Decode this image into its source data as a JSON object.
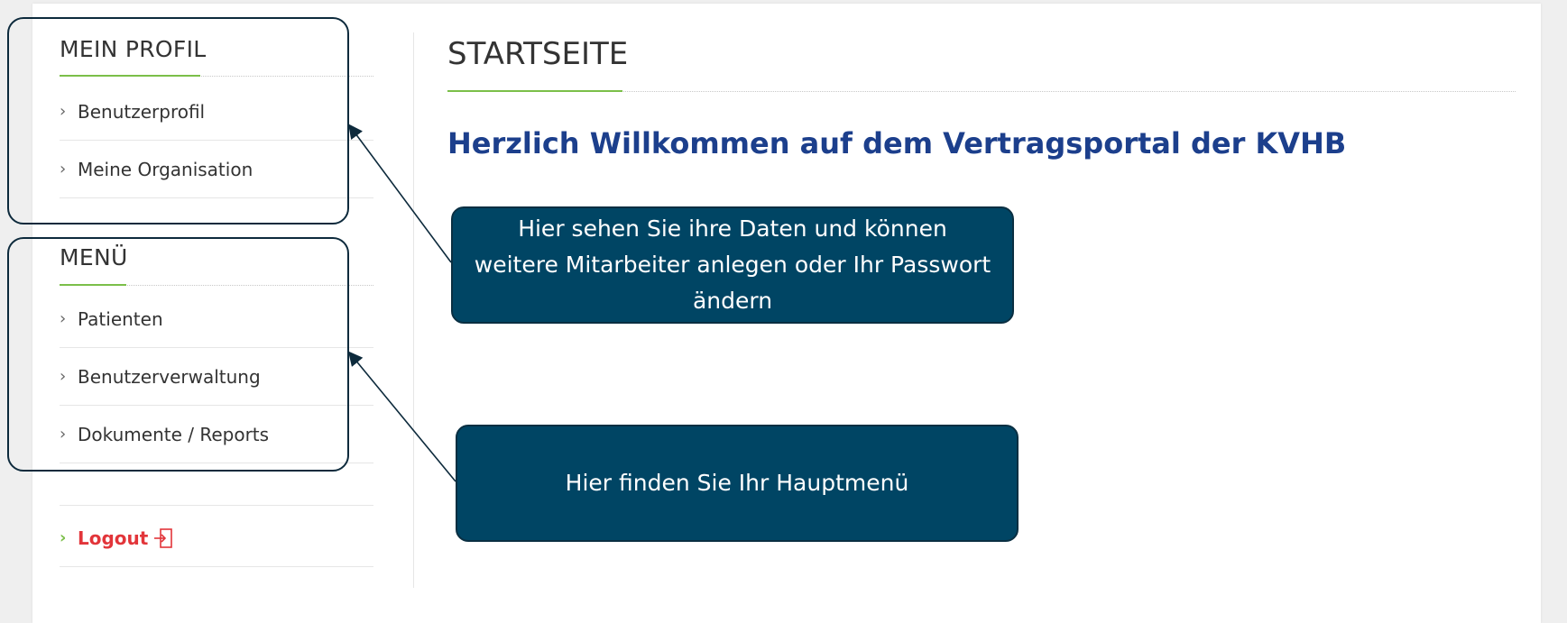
{
  "sidebar": {
    "profile": {
      "title": "MEIN PROFIL",
      "items": [
        {
          "label": "Benutzerprofil"
        },
        {
          "label": "Meine Organisation"
        }
      ]
    },
    "menu": {
      "title": "MENÜ",
      "items": [
        {
          "label": "Patienten"
        },
        {
          "label": "Benutzerverwaltung"
        },
        {
          "label": "Dokumente / Reports"
        }
      ]
    },
    "logout": {
      "label": "Logout",
      "icon": "logout-icon"
    }
  },
  "main": {
    "title": "STARTSEITE",
    "welcome": "Herzlich Willkommen auf dem Vertragsportal der KVHB"
  },
  "tooltips": {
    "profile_hint": "Hier sehen Sie ihre Daten und können weitere Mitarbeiter anlegen oder Ihr Passwort ändern",
    "menu_hint": "Hier finden Sie Ihr Hauptmenü"
  },
  "colors": {
    "accent_green": "#7bbf49",
    "logout_red": "#e2353a",
    "heading_blue": "#1c3f8c",
    "tooltip_bg": "#004564"
  }
}
